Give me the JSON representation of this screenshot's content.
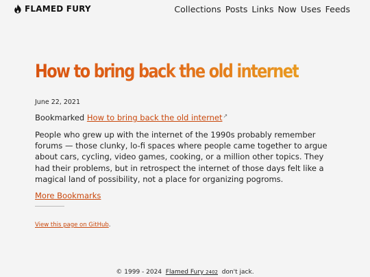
{
  "header": {
    "brand": "FLAMED FURY",
    "brand_icon": "flame-icon",
    "nav": [
      "Collections",
      "Posts",
      "Links",
      "Now",
      "Uses",
      "Feeds"
    ]
  },
  "post": {
    "title": "How to bring back the old internet",
    "date": "June 22, 2021",
    "bookmarked_prefix": "Bookmarked",
    "bookmarked_link": "How to bring back the old internet",
    "external_icon": "external-link-icon",
    "body": "People who grew up with the internet of the 1990s probably remember forums — those clunky, lo-fi spaces where people came together to argue about cars, cycling, video games, cooking, or a million other topics. They had their problems, but in retrospect the internet of those days felt like a magical land of possibility, not a place for organizing pogroms.",
    "more_link": "More Bookmarks",
    "github_link": "View this page on GitHub",
    "github_suffix": "."
  },
  "footer": {
    "copyright": "© 1999 - 2024",
    "site_link": "Flamed Fury",
    "version": "2402",
    "tagline": "don't jack."
  },
  "colors": {
    "accent": "#c9470b",
    "title_gradient_start": "#d8530f",
    "title_gradient_end": "#e99a1f",
    "background": "#f4f4f4",
    "text": "#222222"
  }
}
